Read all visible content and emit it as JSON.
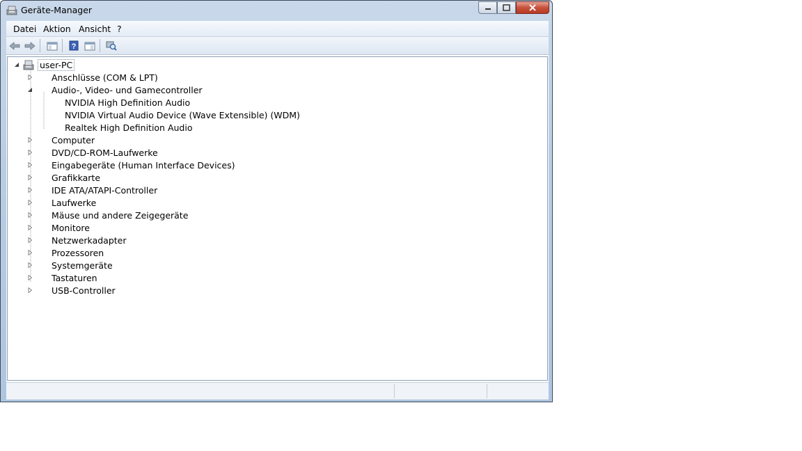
{
  "window": {
    "title": "Geräte-Manager"
  },
  "menu": [
    {
      "label": "Datei"
    },
    {
      "label": "Aktion"
    },
    {
      "label": "Ansicht"
    },
    {
      "label": "?"
    }
  ],
  "toolbar": {
    "icons": [
      "back-icon",
      "forward-icon",
      "show-hide-console-tree-icon",
      "help-icon",
      "properties-icon",
      "scan-hardware-icon"
    ]
  },
  "tree": {
    "root": {
      "label": "user-PC",
      "expanded": true
    },
    "categories": [
      {
        "label": "Anschlüsse (COM & LPT)",
        "icon": "port-icon",
        "expanded": false
      },
      {
        "label": "Audio-, Video- und Gamecontroller",
        "icon": "speaker-icon",
        "expanded": true,
        "children": [
          {
            "label": "NVIDIA High Definition Audio",
            "icon": "speaker-icon"
          },
          {
            "label": "NVIDIA Virtual Audio Device (Wave Extensible) (WDM)",
            "icon": "speaker-icon"
          },
          {
            "label": "Realtek High Definition Audio",
            "icon": "speaker-icon"
          }
        ]
      },
      {
        "label": "Computer",
        "icon": "computer-icon",
        "expanded": false
      },
      {
        "label": "DVD/CD-ROM-Laufwerke",
        "icon": "dvd-drive-icon",
        "expanded": false
      },
      {
        "label": "Eingabegeräte (Human Interface Devices)",
        "icon": "hid-icon",
        "expanded": false
      },
      {
        "label": "Grafikkarte",
        "icon": "display-adapter-icon",
        "expanded": false
      },
      {
        "label": "IDE ATA/ATAPI-Controller",
        "icon": "ide-controller-icon",
        "expanded": false
      },
      {
        "label": "Laufwerke",
        "icon": "disk-drive-icon",
        "expanded": false
      },
      {
        "label": "Mäuse und andere Zeigegeräte",
        "icon": "mouse-icon",
        "expanded": false
      },
      {
        "label": "Monitore",
        "icon": "monitor-icon",
        "expanded": false
      },
      {
        "label": "Netzwerkadapter",
        "icon": "network-adapter-icon",
        "expanded": false
      },
      {
        "label": "Prozessoren",
        "icon": "processor-icon",
        "expanded": false
      },
      {
        "label": "Systemgeräte",
        "icon": "system-devices-icon",
        "expanded": false
      },
      {
        "label": "Tastaturen",
        "icon": "keyboard-icon",
        "expanded": false
      },
      {
        "label": "USB-Controller",
        "icon": "usb-icon",
        "expanded": false
      }
    ]
  },
  "statusbar": {
    "text": ""
  }
}
